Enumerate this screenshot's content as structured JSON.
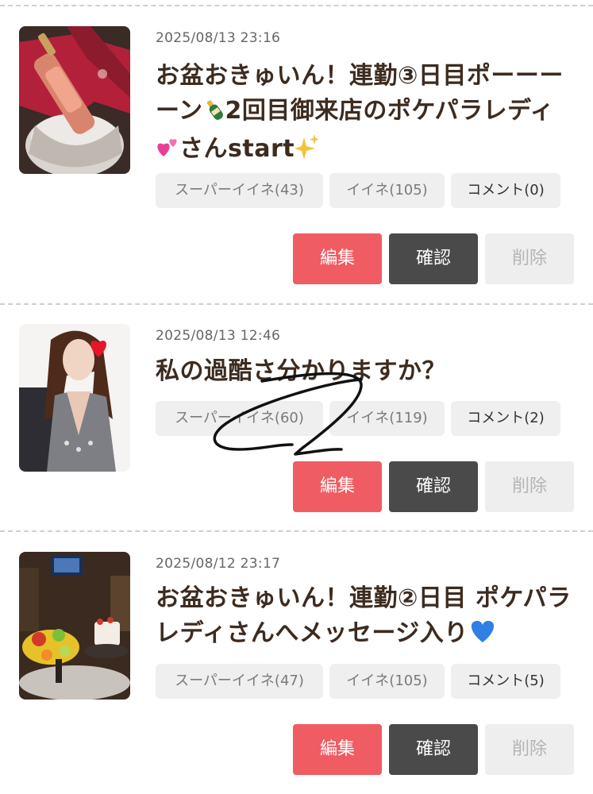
{
  "posts": [
    {
      "date": "2025/08/13 23:16",
      "title_part1": "お盆おきゅいん！連勤③日目ポーーーーン",
      "title_part2": "2回目御来店のポケパラレディ",
      "title_part3": "さんstart",
      "title_emojis": [
        "champagne-bottle-icon",
        "two-hearts-icon",
        "sparkles-icon"
      ],
      "super_like": "スーパーイイネ(43)",
      "like": "イイネ(105)",
      "comment": "コメント(0)",
      "edit": "編集",
      "confirm": "確認",
      "delete": "削除"
    },
    {
      "date": "2025/08/13 12:46",
      "title": "私の過酷さ分かりますか？",
      "super_like": "スーパーイイネ(60)",
      "like": "イイネ(119)",
      "comment": "コメント(2)",
      "edit": "編集",
      "confirm": "確認",
      "delete": "削除"
    },
    {
      "date": "2025/08/12 23:17",
      "title": "お盆おきゅいん！連勤②日目 ポケパラレディさんへメッセージ入り",
      "title_emojis": [
        "blue-heart-icon"
      ],
      "super_like": "スーパーイイネ(47)",
      "like": "イイネ(105)",
      "comment": "コメント(5)",
      "edit": "編集",
      "confirm": "確認",
      "delete": "削除"
    }
  ],
  "colors": {
    "edit_button": "#ef5c62",
    "confirm_button": "#4a4a4a",
    "delete_button": "#eeeeee",
    "title_text": "#3d2b1f",
    "chip_bg": "#efefef"
  }
}
